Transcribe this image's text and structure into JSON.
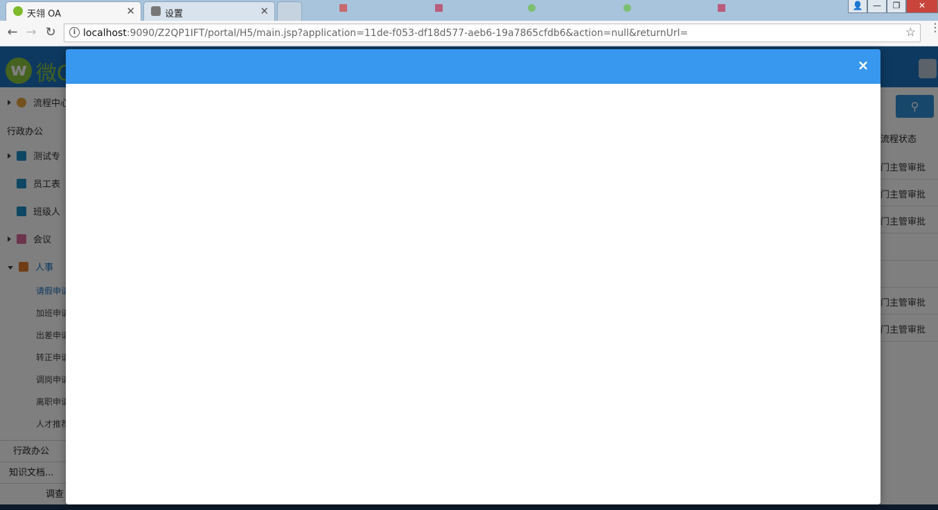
{
  "browser": {
    "tabs": [
      {
        "title": "天翎 OA",
        "active": true
      },
      {
        "title": "设置",
        "active": false
      }
    ],
    "url_host": "localhost",
    "url_rest": ":9090/Z2QP1IFT/portal/H5/main.jsp?application=11de-f053-df18d577-aeb6-19a7865cfdb6&action=null&returnUrl=",
    "nav": {
      "back": "←",
      "forward": "→",
      "reload": "↻",
      "star": "☆",
      "info": "i",
      "menu": "⋮"
    },
    "window_controls": {
      "user": "👤",
      "minimize": "—",
      "maximize": "❐",
      "close": "✕"
    }
  },
  "app": {
    "logo_letter": "w",
    "logo_text": "微C",
    "sidebar": {
      "top_item": "流程中心",
      "section_title": "行政办公",
      "items": [
        {
          "label": "测试专",
          "color": "#1c8fc7"
        },
        {
          "label": "员工表",
          "color": "#1c8fc7"
        },
        {
          "label": "班级人",
          "color": "#1c8fc7"
        }
      ],
      "folders": [
        {
          "label": "会议",
          "color": "#d86a9a"
        },
        {
          "label": "人事",
          "color": "#e07a2e"
        }
      ],
      "sub_items": [
        "请假申请",
        "加班申请",
        "出差申请",
        "转正申请",
        "调岗申请",
        "离职申请",
        "人才推荐"
      ],
      "bottom": [
        "行政办公",
        "知识文档...",
        "调查"
      ]
    },
    "table": {
      "column_header": "流程状态",
      "cells": [
        "门主管审批",
        "门主管审批",
        "门主管审批",
        "",
        "",
        "门主管审批",
        "门主管审批"
      ]
    }
  },
  "modal": {
    "close_label": "×",
    "header_color": "#3897ef"
  }
}
